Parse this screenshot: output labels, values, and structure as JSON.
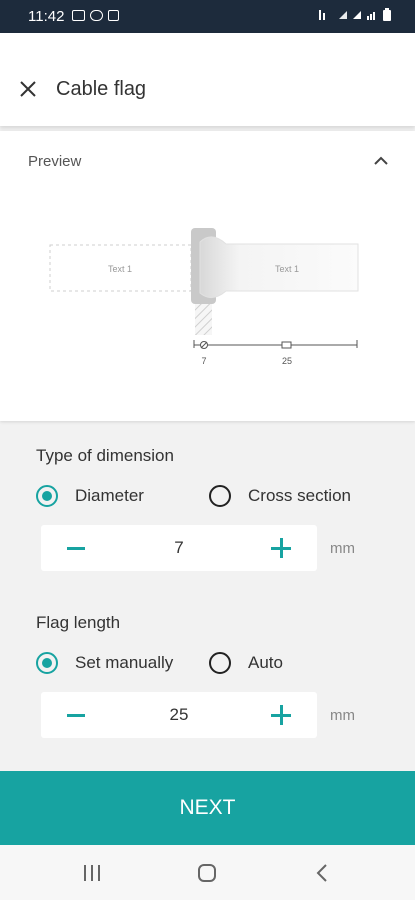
{
  "status_bar": {
    "time": "11:42"
  },
  "header": {
    "title": "Cable flag"
  },
  "preview": {
    "label": "Preview",
    "flag_left_text": "Text 1",
    "flag_right_text": "Text 1",
    "diameter_value": "7",
    "flag_length_value": "25"
  },
  "dimension": {
    "title": "Type of dimension",
    "options": [
      "Diameter",
      "Cross section"
    ],
    "selected": "Diameter",
    "value": "7",
    "unit": "mm"
  },
  "flag_length": {
    "title": "Flag length",
    "options": [
      "Set manually",
      "Auto"
    ],
    "selected": "Set manually",
    "value": "25",
    "unit": "mm"
  },
  "next_button": {
    "label": "NEXT"
  },
  "colors": {
    "accent": "#17a3a1",
    "status_bar": "#1d2b3c"
  }
}
